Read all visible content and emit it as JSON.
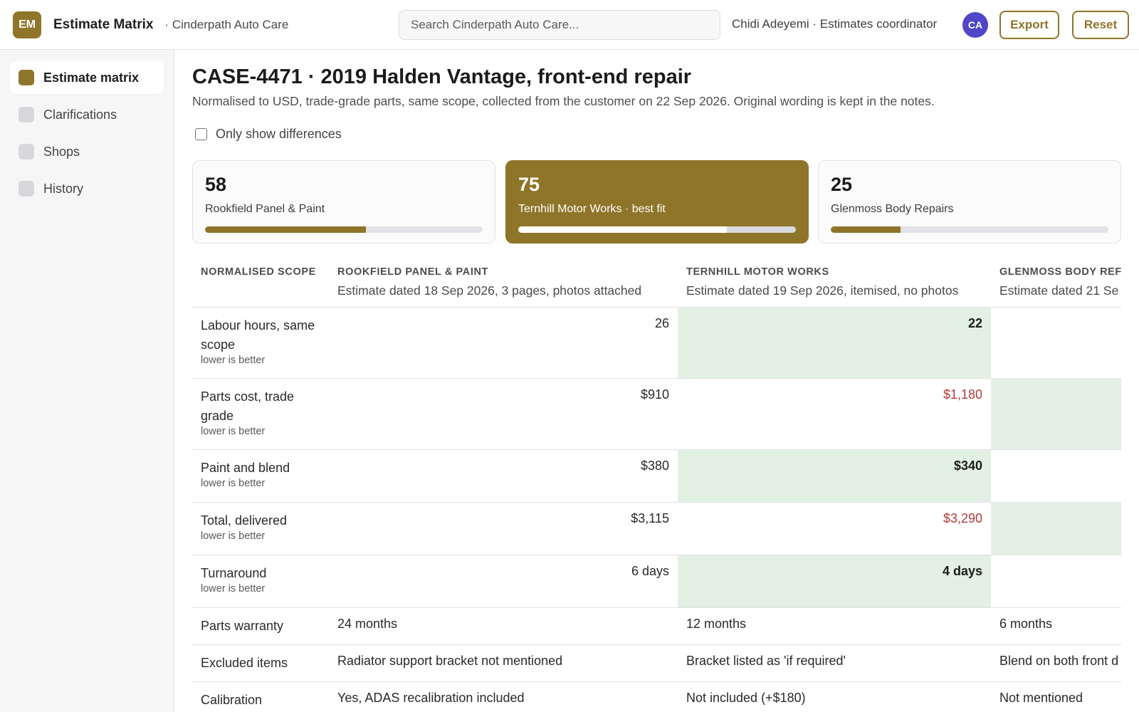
{
  "app": {
    "logo_initials": "EM",
    "title": "Estimate Matrix",
    "org": "· Cinderpath Auto Care"
  },
  "search": {
    "placeholder": "Search Cinderpath Auto Care..."
  },
  "user": {
    "label": "Chidi Adeyemi · Estimates coordinator",
    "initials": "CA"
  },
  "actions": {
    "export_label": "Export",
    "reset_label": "Reset"
  },
  "sidebar": {
    "items": [
      {
        "label": "Estimate matrix",
        "active": true
      },
      {
        "label": "Clarifications",
        "active": false
      },
      {
        "label": "Shops",
        "active": false
      },
      {
        "label": "History",
        "active": false
      }
    ]
  },
  "case": {
    "title": "CASE-4471 · 2019 Halden Vantage, front-end repair",
    "subtitle": "Normalised to USD, trade-grade parts, same scope, collected from the customer on 22 Sep 2026. Original wording is kept in the notes.",
    "diff_toggle_label": "Only show differences",
    "diff_toggle_checked": false
  },
  "scores": [
    {
      "score": "58",
      "label": "Rookfield Panel & Paint",
      "fraction": 0.58,
      "best": false
    },
    {
      "score": "75",
      "label": "Ternhill Motor Works · best fit",
      "fraction": 0.75,
      "best": true
    },
    {
      "score": "25",
      "label": "Glenmoss Body Repairs",
      "fraction": 0.25,
      "best": false
    }
  ],
  "table": {
    "scope_header": "NORMALISED SCOPE",
    "shops": [
      {
        "name": "ROOKFIELD PANEL & PAINT",
        "sub": "Estimate dated 18 Sep 2026, 3 pages, photos attached"
      },
      {
        "name": "TERNHILL MOTOR WORKS",
        "sub": "Estimate dated 19 Sep 2026, itemised, no photos"
      },
      {
        "name": "GLENMOSS BODY REF",
        "sub": "Estimate dated 21 Se"
      }
    ],
    "rows": [
      {
        "label": "Labour hours, same scope",
        "hint": "lower is better",
        "kind": "num",
        "cells": [
          {
            "value": "26",
            "best": false,
            "worst": false
          },
          {
            "value": "22",
            "best": true,
            "worst": false
          },
          {
            "value": "",
            "best": false,
            "worst": false
          }
        ]
      },
      {
        "label": "Parts cost, trade grade",
        "hint": "lower is better",
        "kind": "num",
        "cells": [
          {
            "value": "$910",
            "best": false,
            "worst": false
          },
          {
            "value": "$1,180",
            "best": false,
            "worst": true
          },
          {
            "value": "",
            "best": true,
            "worst": false
          }
        ]
      },
      {
        "label": "Paint and blend",
        "hint": "lower is better",
        "kind": "num",
        "cells": [
          {
            "value": "$380",
            "best": false,
            "worst": false
          },
          {
            "value": "$340",
            "best": true,
            "worst": false
          },
          {
            "value": "",
            "best": false,
            "worst": false
          }
        ]
      },
      {
        "label": "Total, delivered",
        "hint": "lower is better",
        "kind": "num",
        "cells": [
          {
            "value": "$3,115",
            "best": false,
            "worst": false
          },
          {
            "value": "$3,290",
            "best": false,
            "worst": true
          },
          {
            "value": "",
            "best": true,
            "worst": false
          }
        ]
      },
      {
        "label": "Turnaround",
        "hint": "lower is better",
        "kind": "num",
        "cells": [
          {
            "value": "6 days",
            "best": false,
            "worst": false
          },
          {
            "value": "4 days",
            "best": true,
            "worst": false
          },
          {
            "value": "",
            "best": false,
            "worst": false
          }
        ]
      },
      {
        "label": "Parts warranty",
        "hint": "",
        "kind": "text",
        "cells": [
          {
            "value": "24 months"
          },
          {
            "value": "12 months"
          },
          {
            "value": "6 months"
          }
        ]
      },
      {
        "label": "Excluded items",
        "hint": "",
        "kind": "text",
        "cells": [
          {
            "value": "Radiator support bracket not mentioned"
          },
          {
            "value": "Bracket listed as 'if required'"
          },
          {
            "value": "Blend on both front d"
          }
        ]
      },
      {
        "label": "Calibration",
        "hint": "",
        "kind": "text",
        "cells": [
          {
            "value": "Yes, ADAS recalibration included"
          },
          {
            "value": "Not included (+$180)"
          },
          {
            "value": "Not mentioned"
          }
        ]
      }
    ]
  },
  "colors": {
    "accent": "#8f7529",
    "best_cell_bg": "#e3f0e4",
    "worst_text": "#b23a3a",
    "avatar": "#4f46c8"
  }
}
